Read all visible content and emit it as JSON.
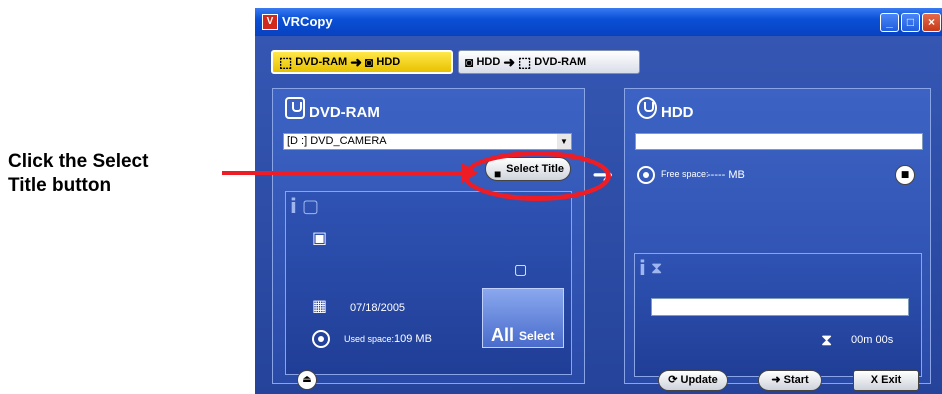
{
  "annotation": {
    "line1": "Click the Select",
    "line2": "Title button"
  },
  "window": {
    "title": "VRCopy",
    "app_icon_label": "V"
  },
  "tabs": [
    {
      "from": "DVD-RAM",
      "to": "HDD",
      "active": true
    },
    {
      "from": "HDD",
      "to": "DVD-RAM",
      "active": false
    }
  ],
  "source": {
    "title": "DVD-RAM",
    "drive_value": "[D :] DVD_CAMERA",
    "select_title_label": "Select Title",
    "date": "07/18/2005",
    "used_space_label": "Used space:",
    "used_space_value": "109 MB",
    "all_select_main": "All",
    "all_select_sub": "Select"
  },
  "destination": {
    "title": "HDD",
    "path_value": "",
    "free_space_label": "Free space:",
    "free_space_value": "----- MB",
    "elapsed_time": "00m 00s"
  },
  "footer": {
    "update_label": "Update",
    "start_label": "Start",
    "exit_label": "Exit"
  },
  "colors": {
    "accent_red": "#ee1c24",
    "active_tab": "#ffe84a",
    "window_bg": "#2b4ea8"
  }
}
